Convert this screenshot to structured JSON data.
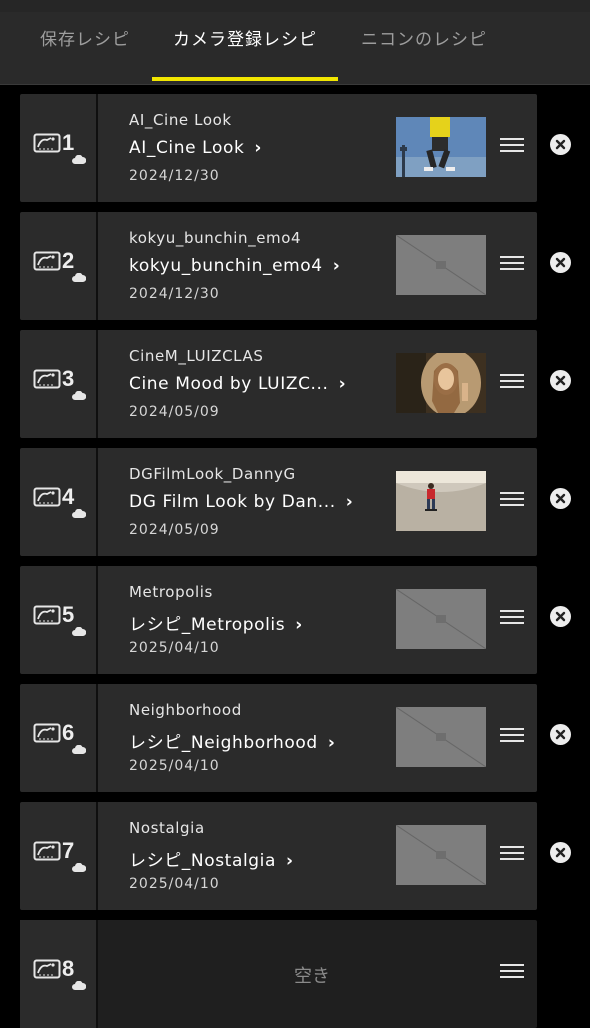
{
  "tabs": [
    {
      "label": "保存レシピ",
      "active": false
    },
    {
      "label": "カメラ登録レシピ",
      "active": true
    },
    {
      "label": "ニコンのレシピ",
      "active": false
    }
  ],
  "accent_color": "#f2e600",
  "recipes": [
    {
      "slot": "1",
      "file_name": "AI_Cine Look",
      "recipe_name": "AI_Cine Look",
      "date": "2024/12/30",
      "thumbnail": "photo-jumping-person"
    },
    {
      "slot": "2",
      "file_name": "kokyu_bunchin_emo4",
      "recipe_name": "kokyu_bunchin_emo4",
      "date": "2024/12/30",
      "thumbnail": "placeholder"
    },
    {
      "slot": "3",
      "file_name": "CineM_LUIZCLAS",
      "recipe_name": "Cine Mood by LUIZC...",
      "date": "2024/05/09",
      "thumbnail": "photo-woman-portrait"
    },
    {
      "slot": "4",
      "file_name": "DGFilmLook_DannyG",
      "recipe_name": "DG Film Look by Dan...",
      "date": "2024/05/09",
      "thumbnail": "photo-skateboarder"
    },
    {
      "slot": "5",
      "file_name": "Metropolis",
      "recipe_name": "レシピ_Metropolis",
      "date": "2025/04/10",
      "thumbnail": "placeholder"
    },
    {
      "slot": "6",
      "file_name": "Neighborhood",
      "recipe_name": "レシピ_Neighborhood",
      "date": "2025/04/10",
      "thumbnail": "placeholder"
    },
    {
      "slot": "7",
      "file_name": "Nostalgia",
      "recipe_name": "レシピ_Nostalgia",
      "date": "2025/04/10",
      "thumbnail": "placeholder"
    }
  ],
  "empty_slot": {
    "slot": "8",
    "label": "空き"
  }
}
